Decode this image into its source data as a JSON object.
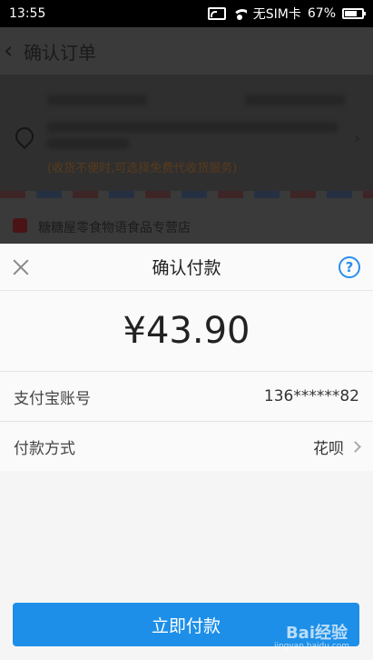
{
  "status_bar": {
    "time": "13:55",
    "sim_text": "无SIM卡",
    "battery": "67%"
  },
  "background_page": {
    "title": "确认订单",
    "address_note": "(收货不便时,可选择免费代收货服务)",
    "shop_name": "糖糖屋零食物语食品专营店"
  },
  "sheet": {
    "title": "确认付款",
    "amount": "¥43.90",
    "account_label": "支付宝账号",
    "account_value": "136******82",
    "method_label": "付款方式",
    "method_value": "花呗",
    "pay_button": "立即付款",
    "help_symbol": "?"
  },
  "watermark": {
    "text": "Bai经验",
    "url": "jingyan.baidu.com"
  }
}
